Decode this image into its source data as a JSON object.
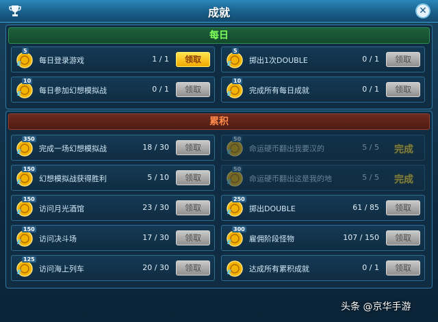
{
  "window": {
    "title": "成就"
  },
  "sections": {
    "daily": {
      "label": "每日"
    },
    "cumulative": {
      "label": "累积"
    }
  },
  "daily": [
    {
      "reward": "5",
      "desc": "每日登录游戏",
      "progress": "1 / 1",
      "button": "领取",
      "state": "claimable"
    },
    {
      "reward": "5",
      "desc": "掷出1次DOUBLE",
      "progress": "0 / 1",
      "button": "领取",
      "state": "locked"
    },
    {
      "reward": "10",
      "desc": "每日参加幻想模拟战",
      "progress": "0 / 1",
      "button": "领取",
      "state": "locked"
    },
    {
      "reward": "10",
      "desc": "完成所有每日成就",
      "progress": "0 / 1",
      "button": "领取",
      "state": "locked"
    }
  ],
  "cumulative": [
    {
      "reward": "350",
      "desc": "完成一场幻想模拟战",
      "progress": "18 / 30",
      "button": "领取",
      "state": "locked"
    },
    {
      "reward": "50",
      "desc": "命运硬币翻出我要汉的",
      "progress": "5 / 5",
      "button": "完成",
      "state": "completed"
    },
    {
      "reward": "150",
      "desc": "幻想模拟战获得胜利",
      "progress": "5 / 10",
      "button": "领取",
      "state": "locked"
    },
    {
      "reward": "50",
      "desc": "命运硬币翻出这是我的地",
      "progress": "5 / 5",
      "button": "完成",
      "state": "completed"
    },
    {
      "reward": "150",
      "desc": "访问月光酒馆",
      "progress": "23 / 30",
      "button": "领取",
      "state": "locked"
    },
    {
      "reward": "250",
      "desc": "掷出DOUBLE",
      "progress": "61 / 85",
      "button": "领取",
      "state": "locked"
    },
    {
      "reward": "150",
      "desc": "访问决斗场",
      "progress": "17 / 30",
      "button": "领取",
      "state": "locked"
    },
    {
      "reward": "300",
      "desc": "雇佣阶段怪物",
      "progress": "107 / 150",
      "button": "领取",
      "state": "locked"
    },
    {
      "reward": "125",
      "desc": "访问海上列车",
      "progress": "20 / 30",
      "button": "领取",
      "state": "locked"
    },
    {
      "reward": "",
      "desc": "达成所有累积成就",
      "progress": "0 / 1",
      "button": "领取",
      "state": "locked"
    }
  ],
  "watermark": "头条 @京华手游"
}
